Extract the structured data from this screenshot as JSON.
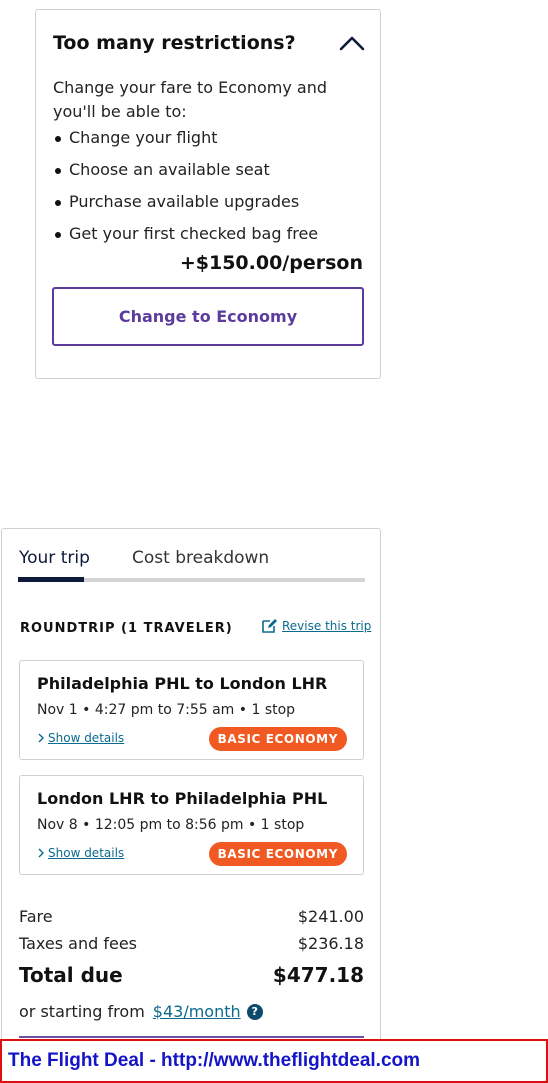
{
  "upsell": {
    "title": "Too many restrictions?",
    "intro": "Change your fare to Economy and you'll be able to:",
    "benefits": [
      "Change your flight",
      "Choose an available seat",
      "Purchase available upgrades",
      "Get your first checked bag free"
    ],
    "price": "+$150.00/person",
    "button_label": "Change to Economy",
    "collapse_icon": "chevron-up-icon"
  },
  "trip": {
    "tabs": [
      {
        "label": "Your trip",
        "active": true
      },
      {
        "label": "Cost breakdown",
        "active": false
      }
    ],
    "heading": "ROUNDTRIP (1 TRAVELER)",
    "revise_label": "Revise this trip",
    "segments": [
      {
        "route": "Philadelphia PHL to London LHR",
        "time": "Nov 1 • 4:27 pm to 7:55 am • 1 stop",
        "details_label": "Show details",
        "fare_badge": "BASIC ECONOMY"
      },
      {
        "route": "London LHR to Philadelphia PHL",
        "time": "Nov 8 • 12:05 pm to 8:56 pm • 1 stop",
        "details_label": "Show details",
        "fare_badge": "BASIC ECONOMY"
      }
    ],
    "costs": {
      "fare_label": "Fare",
      "fare_value": "$241.00",
      "taxes_label": "Taxes and fees",
      "taxes_value": "$236.18",
      "total_label": "Total due",
      "total_value": "$477.18"
    },
    "monthly": {
      "prefix": "or starting from",
      "link": "$43/month",
      "help_glyph": "?"
    }
  },
  "banner": {
    "text": "The Flight Deal - http://www.theflightdeal.com"
  },
  "colors": {
    "brand_purple": "#5b3c9d",
    "link_teal": "#0b6a8f",
    "navy": "#0e1a3a",
    "badge_orange": "#f05a22",
    "banner_red": "#e01010",
    "banner_blue": "#1414c8"
  }
}
